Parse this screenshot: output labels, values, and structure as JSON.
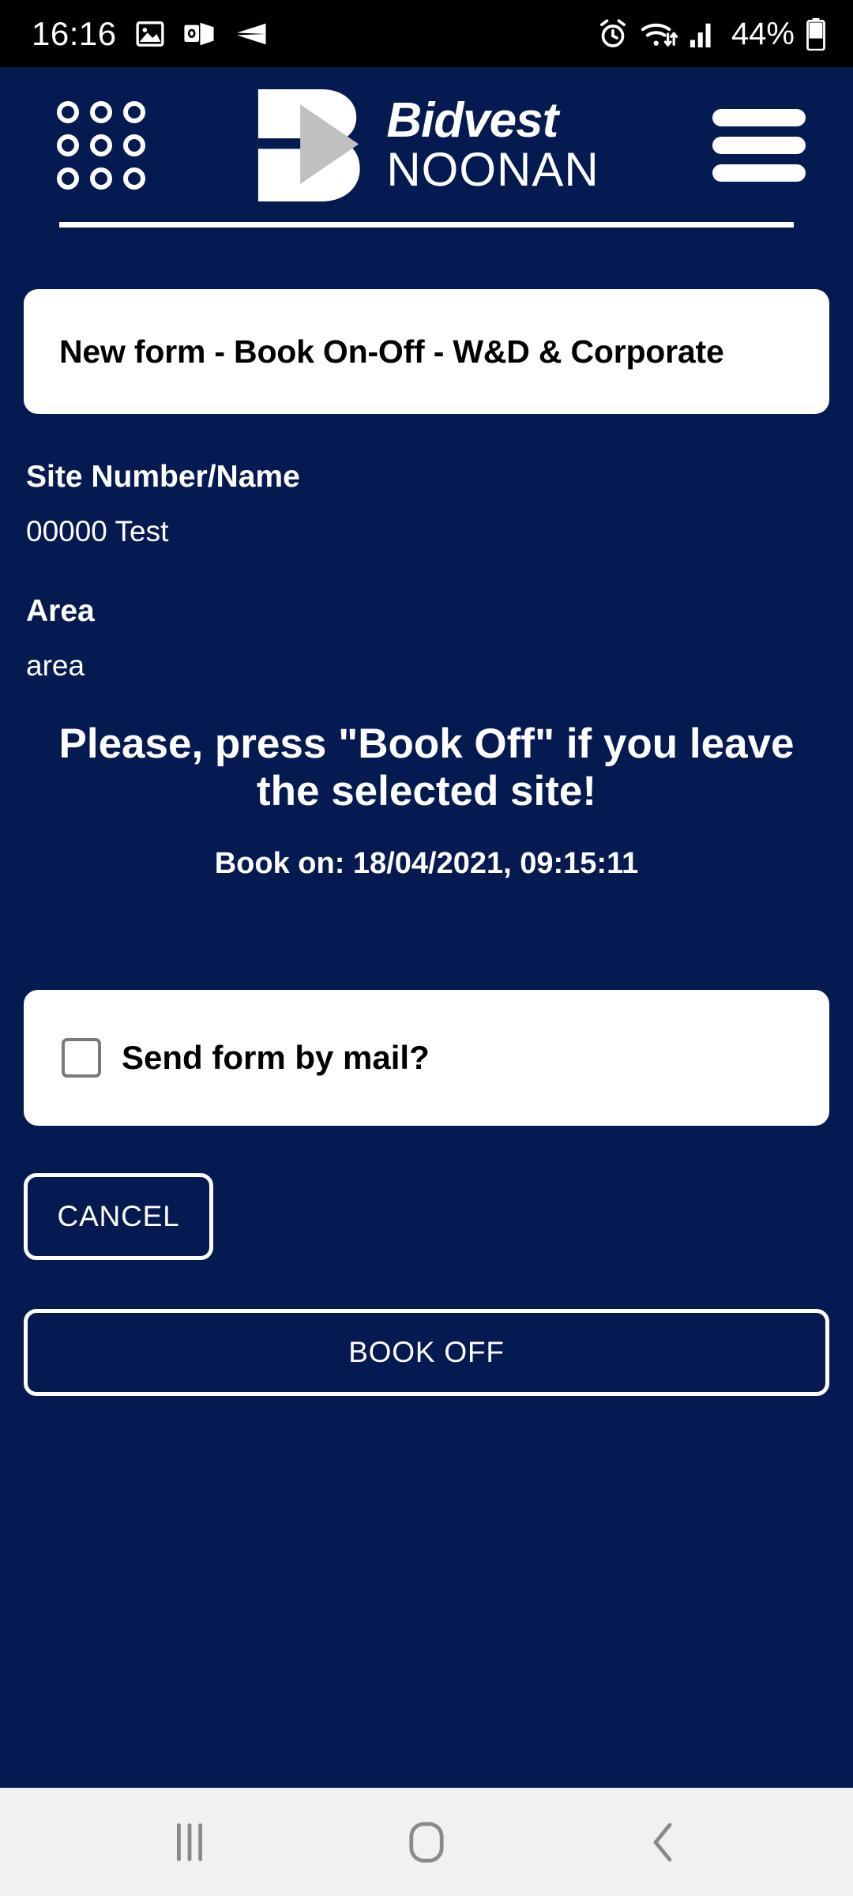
{
  "status_bar": {
    "time": "16:16",
    "battery_percent": "44%",
    "left_icons": [
      "image-icon",
      "outlook-icon",
      "send-icon"
    ],
    "right_icons": [
      "alarm-icon",
      "wifi-icon",
      "signal-icon",
      "battery-icon"
    ]
  },
  "header": {
    "grid_icon": "apps-grid-icon",
    "menu_icon": "hamburger-menu-icon",
    "logo": {
      "mark": "bidvest-b-mark-icon",
      "line1": "Bidvest",
      "line2": "NOONAN"
    }
  },
  "form": {
    "title": "New form - Book On-Off - W&D & Corporate",
    "fields": [
      {
        "label": "Site Number/Name",
        "value": "00000 Test"
      },
      {
        "label": "Area",
        "value": "area"
      }
    ],
    "notice": "Please, press \"Book Off\" if you leave the selected site!",
    "book_on": "Book on: 18/04/2021, 09:15:11",
    "checkbox": {
      "label": "Send form by mail?",
      "checked": false
    },
    "buttons": {
      "cancel": "CANCEL",
      "book_off": "BOOK OFF"
    }
  },
  "nav_bar": {
    "recents": "recents-icon",
    "home": "home-icon",
    "back": "back-icon"
  },
  "colors": {
    "background": "#061A52",
    "card": "#ffffff",
    "text_on_dark": "#ffffff",
    "text_on_card": "#000000",
    "status_bar": "#000000",
    "nav_bar": "#f1f1f1",
    "logo_triangle": "#c0c0c0",
    "checkbox_border": "#7a7a7a"
  }
}
